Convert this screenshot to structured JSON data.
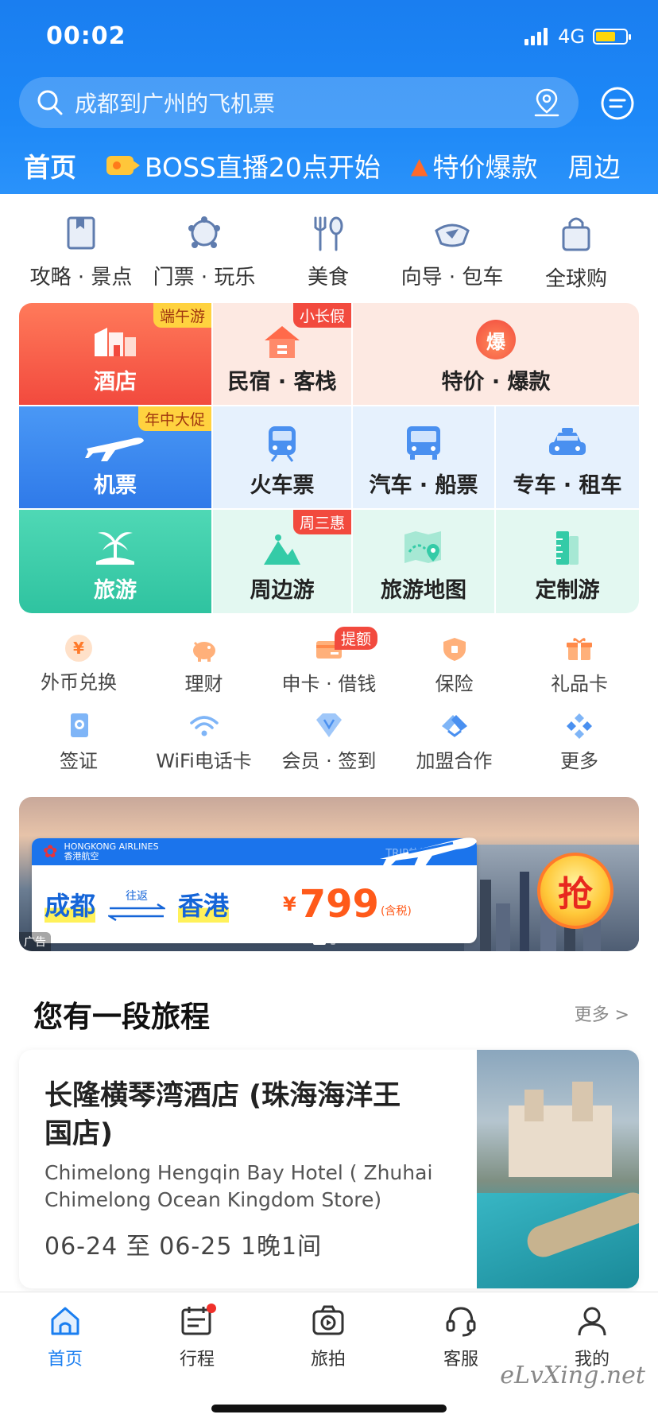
{
  "status": {
    "time": "00:02",
    "network": "4G"
  },
  "search": {
    "placeholder": "成都到广州的飞机票"
  },
  "header_tabs": [
    {
      "label": "首页"
    },
    {
      "label": "BOSS直播20点开始"
    },
    {
      "label": "特价爆款"
    },
    {
      "label": "周边"
    }
  ],
  "top_icons": [
    {
      "label": "攻略 · 景点",
      "icon": "guide-icon"
    },
    {
      "label": "门票 · 玩乐",
      "icon": "ticket-icon"
    },
    {
      "label": "美食",
      "icon": "food-icon"
    },
    {
      "label": "向导 · 包车",
      "icon": "guide-car-icon"
    },
    {
      "label": "全球购",
      "icon": "shopping-bag-icon"
    }
  ],
  "grid": {
    "hotel": {
      "label": "酒店",
      "badge": "端午游"
    },
    "homestay": {
      "label": "民宿 · 客栈",
      "badge": "小长假"
    },
    "special": {
      "label": "特价 · 爆款",
      "icon_text": "爆"
    },
    "flight": {
      "label": "机票",
      "badge": "年中大促"
    },
    "train": {
      "label": "火车票"
    },
    "bus": {
      "label": "汽车 · 船票"
    },
    "car": {
      "label": "专车 · 租车"
    },
    "travel": {
      "label": "旅游"
    },
    "nearby": {
      "label": "周边游",
      "badge": "周三惠"
    },
    "map": {
      "label": "旅游地图"
    },
    "custom": {
      "label": "定制游"
    }
  },
  "finance_row1": [
    {
      "label": "外币兑换",
      "icon_text": "¥"
    },
    {
      "label": "理财"
    },
    {
      "label": "申卡 · 借钱",
      "badge": "提额"
    },
    {
      "label": "保险"
    },
    {
      "label": "礼品卡"
    }
  ],
  "finance_row2": [
    {
      "label": "签证"
    },
    {
      "label": "WiFi电话卡"
    },
    {
      "label": "会员 · 签到"
    },
    {
      "label": "加盟合作"
    },
    {
      "label": "更多"
    }
  ],
  "banner": {
    "airline_en": "HONGKONG AIRLINES",
    "airline_cn": "香港航空",
    "watermark": "TRIP航旅",
    "from": "成都",
    "round_trip": "往返",
    "to": "香港",
    "currency": "¥",
    "price": "799",
    "tax": "(含税)",
    "grab": "抢",
    "ad": "广告"
  },
  "trip": {
    "section_title": "您有一段旅程",
    "more": "更多 >",
    "hotel_name": "长隆横琴湾酒店 (珠海海洋王国店)",
    "hotel_en": "Chimelong Hengqin Bay Hotel ( Zhuhai Chimelong Ocean Kingdom Store)",
    "dates": "06-24  至  06-25  1晚1间"
  },
  "nav": [
    {
      "label": "首页",
      "icon": "home-icon"
    },
    {
      "label": "行程",
      "icon": "calendar-icon"
    },
    {
      "label": "旅拍",
      "icon": "camera-icon"
    },
    {
      "label": "客服",
      "icon": "headset-icon"
    },
    {
      "label": "我的",
      "icon": "user-icon"
    }
  ],
  "watermark": "eLvXing.net",
  "colors": {
    "brand_blue": "#1a7ef0",
    "hotel_red": "#f4584a",
    "flight_blue": "#3b86f0",
    "travel_green": "#34cba7"
  }
}
